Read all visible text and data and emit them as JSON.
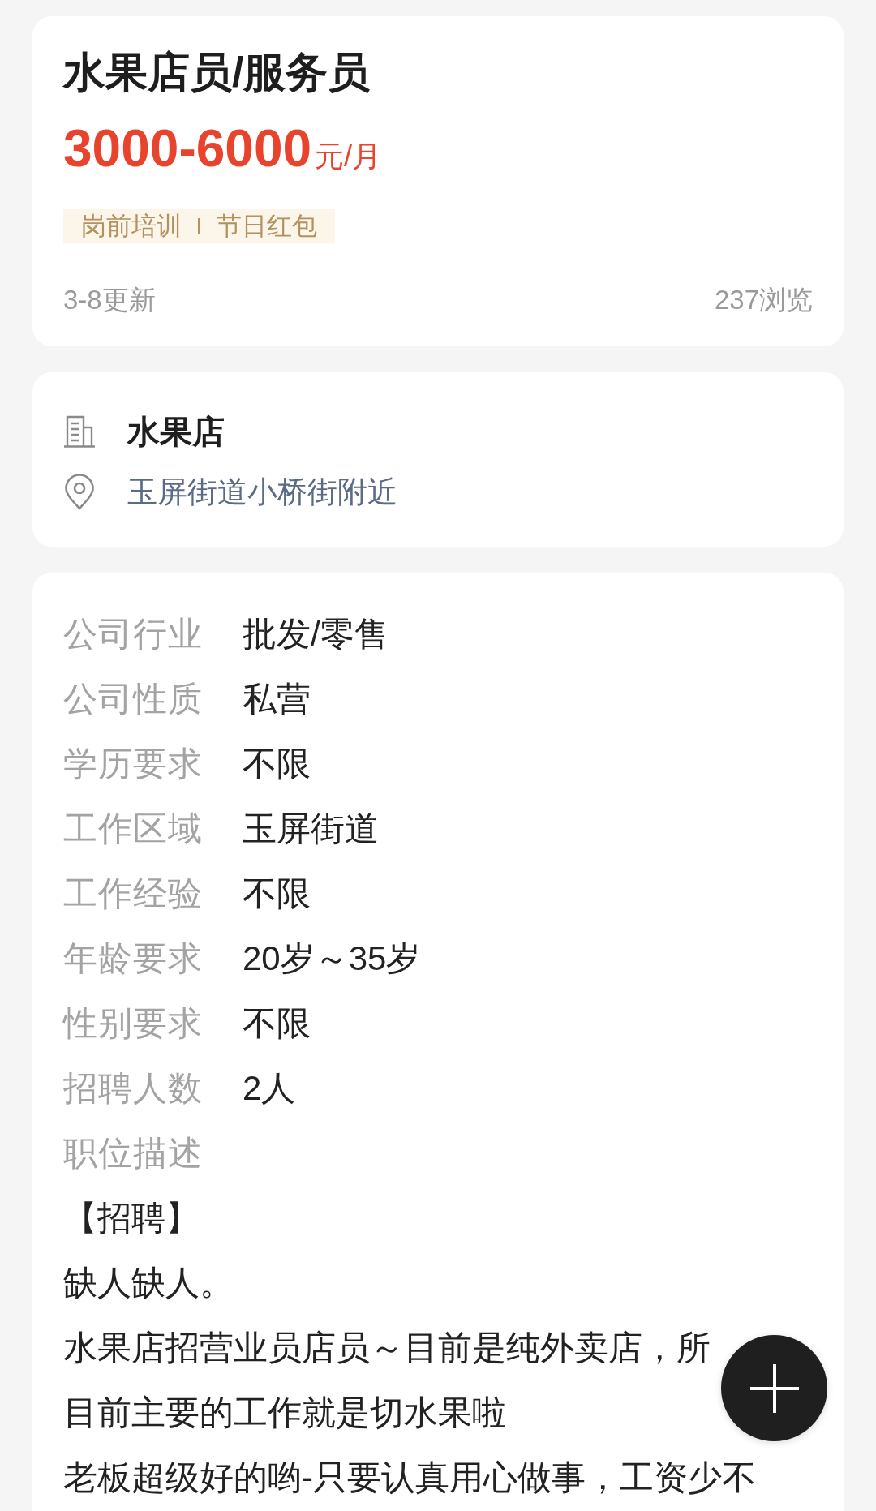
{
  "job": {
    "title": "水果店员/服务员",
    "salary": {
      "amount": "3000-6000",
      "unit": "元/月"
    },
    "benefits": [
      "岗前培训",
      "节日红包"
    ],
    "updated": "3-8更新",
    "views": "237浏览"
  },
  "company": {
    "name": "水果店",
    "address": "玉屏街道小桥街附近"
  },
  "details": [
    {
      "label": "公司行业",
      "value": "批发/零售"
    },
    {
      "label": "公司性质",
      "value": "私营"
    },
    {
      "label": "学历要求",
      "value": "不限"
    },
    {
      "label": "工作区域",
      "value": "玉屏街道"
    },
    {
      "label": "工作经验",
      "value": "不限"
    },
    {
      "label": "年龄要求",
      "value": "20岁～35岁"
    },
    {
      "label": "性别要求",
      "value": "不限"
    },
    {
      "label": "招聘人数",
      "value": "2人"
    }
  ],
  "description": {
    "label": "职位描述",
    "lines": [
      "【招聘】",
      "缺人缺人。",
      "水果店招营业员店员～目前是纯外卖店，所",
      "目前主要的工作就是切水果啦",
      "老板超级好的哟-只要认真用心做事，工资少不"
    ]
  }
}
